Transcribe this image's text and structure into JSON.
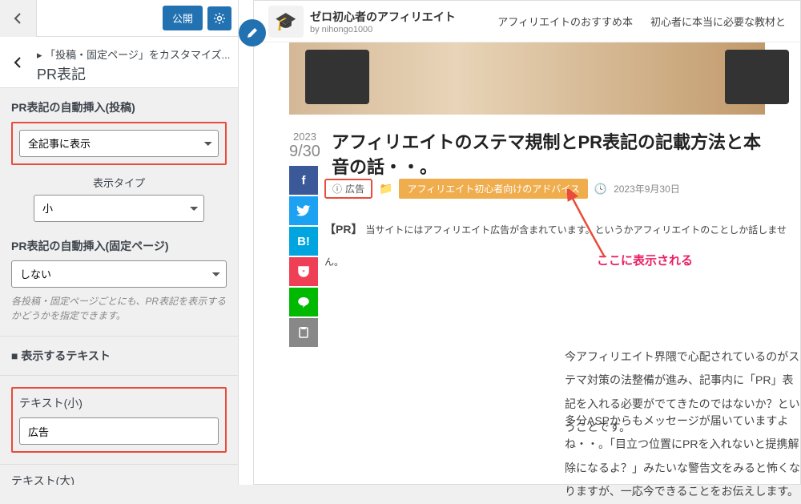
{
  "sidebar": {
    "publish_label": "公開",
    "breadcrumb_prefix": "▸",
    "breadcrumb_text": "「投稿・固定ページ」をカスタマイズ...",
    "breadcrumb_title": "PR表記",
    "section1_label": "PR表記の自動挿入(投稿)",
    "select1_value": "全記事に表示",
    "display_type_label": "表示タイプ",
    "display_type_value": "小",
    "section2_label": "PR表記の自動挿入(固定ページ)",
    "select2_value": "しない",
    "desc_text": "各投稿・固定ページごとにも、PR表記を表示するかどうかを指定できます。",
    "heading_text": "■ 表示するテキスト",
    "text_small_label": "テキスト(小)",
    "text_small_value": "広告",
    "text_large_label": "テキスト(大)"
  },
  "preview": {
    "brand_title": "ゼロ初心者のアフィリエイト",
    "brand_sub": "by nihongo1000",
    "nav1": "アフィリエイトのおすすめ本",
    "nav2": "初心者に本当に必要な教材と",
    "date_year": "2023",
    "date_md": "9/30",
    "article_title": "アフィリエイトのステマ規制とPR表記の記載方法と本音の話・・。",
    "ad_badge_text": "広告",
    "category": "アフィリエイト初心者向けのアドバイス",
    "post_date": "2023年9月30日",
    "pr_intro": "【PR】",
    "pr_rest": "当サイトにはアフィリエイト広告が含まれています。というかアフィリエイトのことしか話しませ",
    "pr_rest2": "ん。",
    "annotation": "ここに表示される",
    "p1": "今アフィリエイト界隈で心配されているのがステマ対策の法整備が進み、記事内に「PR」表記を入れる必要がでてきたのではないか？ということです。",
    "p2": "多分ASPからもメッセージが届いていますよね・・。「目立つ位置にPRを入れないと提携解除になるよ？」みたいな警告文をみると怖くなりますが、一応今できることをお伝えします。",
    "share_hb": "B!"
  }
}
